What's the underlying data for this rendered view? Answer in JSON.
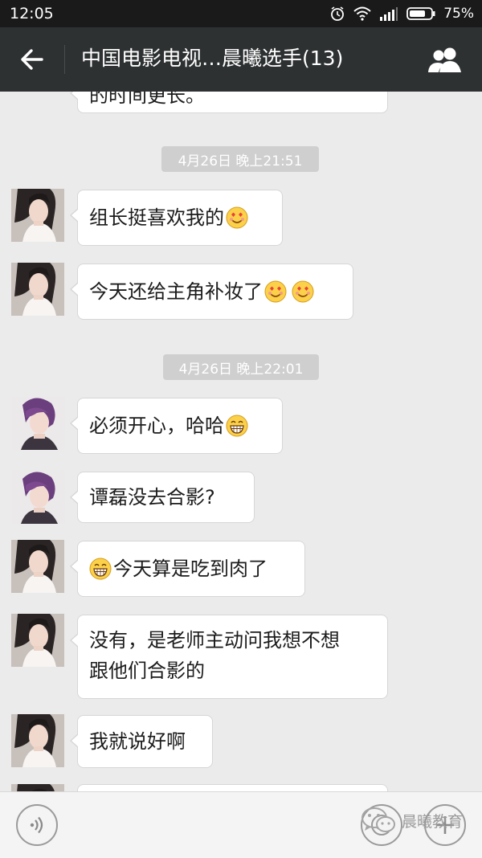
{
  "status": {
    "time": "12:05",
    "battery": "75%"
  },
  "header": {
    "title": "中国电影电视…晨曦选手(13)"
  },
  "chat": {
    "partial_top_text": "的时间更长。",
    "time_badges": [
      "4月26日 晚上21:51",
      "4月26日 晚上22:01"
    ],
    "messages": [
      {
        "text": "组长挺喜欢我的"
      },
      {
        "text": "今天还给主角补妆了"
      },
      {
        "text": "必须开心，哈哈"
      },
      {
        "text": "谭磊没去合影?"
      },
      {
        "text": "今天算是吃到肉了"
      },
      {
        "line1": "没有，是老师主动问我想不想",
        "line2": "跟他们合影的"
      },
      {
        "text": "我就说好啊"
      }
    ]
  },
  "watermark": {
    "text": "晨曦教育"
  },
  "colors": {
    "statusbar": "#1a1a1a",
    "topbar": "#2e3132",
    "chat_bg": "#ebebeb",
    "bubble": "#ffffff",
    "badge": "#cfcfcf"
  },
  "icons": [
    "back-arrow-icon",
    "group-members-icon",
    "voice-icon",
    "emoji-icon",
    "plus-icon",
    "alarm-icon",
    "wifi-icon",
    "signal-icon",
    "battery-icon"
  ]
}
